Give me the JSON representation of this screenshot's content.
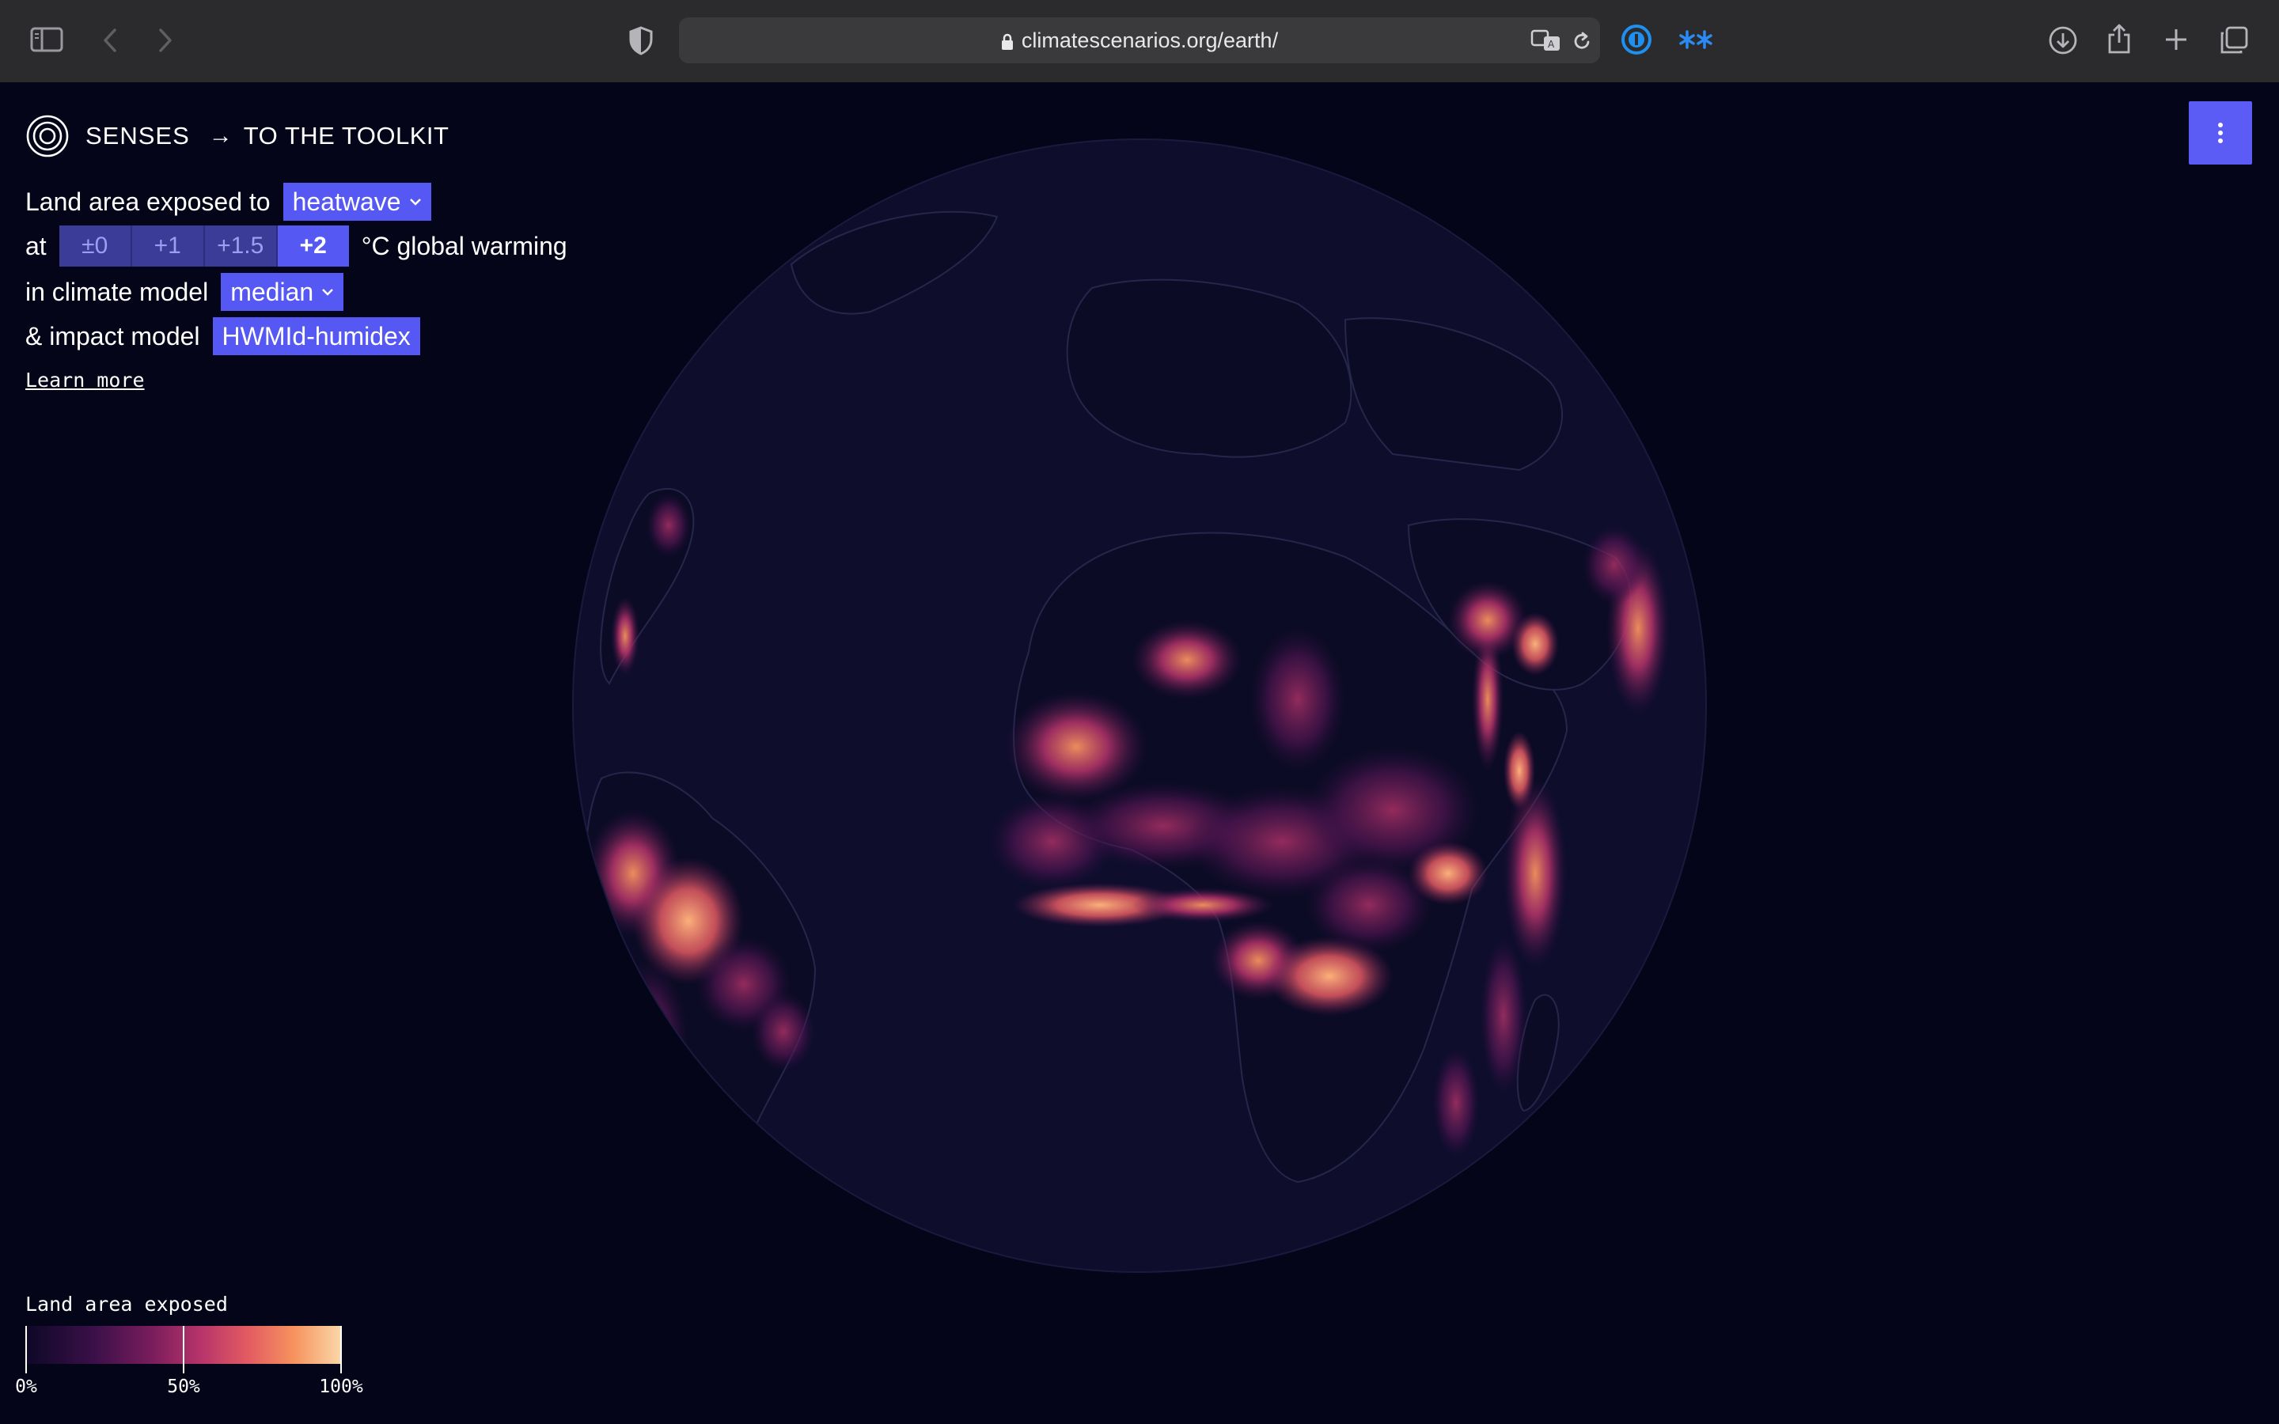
{
  "browser": {
    "url": "climatescenarios.org/earth/"
  },
  "header": {
    "brand": "SENSES",
    "arrow": "→",
    "toolkit_link": "TO THE TOOLKIT"
  },
  "controls": {
    "row1_prefix": "Land area exposed to",
    "hazard": "heatwave",
    "row2_prefix": "at",
    "warming_options": [
      "±0",
      "+1",
      "+1.5",
      "+2"
    ],
    "warming_selected": "+2",
    "row2_suffix": "°C global warming",
    "row3_prefix": "in climate model",
    "climate_model": "median",
    "row4_prefix": "& impact model",
    "impact_model": "HWMId-humidex",
    "learn_more": "Learn more"
  },
  "legend": {
    "title": "Land area exposed",
    "ticks": [
      "0%",
      "50%",
      "100%"
    ],
    "tick_values": [
      0,
      50,
      100
    ],
    "colors": [
      "#0d0826",
      "#3b1049",
      "#7a1d5c",
      "#b5336a",
      "#e25a62",
      "#f6935e",
      "#fbd9aa"
    ]
  },
  "colors": {
    "accent": "#5558f2",
    "background": "#05051a",
    "globe_ocean": "#0e0d2c"
  }
}
